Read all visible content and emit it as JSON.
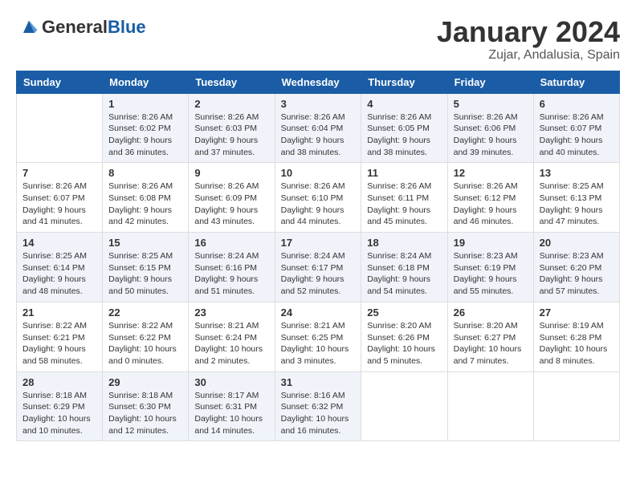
{
  "header": {
    "logo": {
      "general": "General",
      "blue": "Blue"
    },
    "title": "January 2024",
    "subtitle": "Zujar, Andalusia, Spain"
  },
  "weekdays": [
    "Sunday",
    "Monday",
    "Tuesday",
    "Wednesday",
    "Thursday",
    "Friday",
    "Saturday"
  ],
  "weeks": [
    [
      {
        "day": "",
        "sunrise": "",
        "sunset": "",
        "daylight": ""
      },
      {
        "day": "1",
        "sunrise": "Sunrise: 8:26 AM",
        "sunset": "Sunset: 6:02 PM",
        "daylight": "Daylight: 9 hours and 36 minutes."
      },
      {
        "day": "2",
        "sunrise": "Sunrise: 8:26 AM",
        "sunset": "Sunset: 6:03 PM",
        "daylight": "Daylight: 9 hours and 37 minutes."
      },
      {
        "day": "3",
        "sunrise": "Sunrise: 8:26 AM",
        "sunset": "Sunset: 6:04 PM",
        "daylight": "Daylight: 9 hours and 38 minutes."
      },
      {
        "day": "4",
        "sunrise": "Sunrise: 8:26 AM",
        "sunset": "Sunset: 6:05 PM",
        "daylight": "Daylight: 9 hours and 38 minutes."
      },
      {
        "day": "5",
        "sunrise": "Sunrise: 8:26 AM",
        "sunset": "Sunset: 6:06 PM",
        "daylight": "Daylight: 9 hours and 39 minutes."
      },
      {
        "day": "6",
        "sunrise": "Sunrise: 8:26 AM",
        "sunset": "Sunset: 6:07 PM",
        "daylight": "Daylight: 9 hours and 40 minutes."
      }
    ],
    [
      {
        "day": "7",
        "sunrise": "Sunrise: 8:26 AM",
        "sunset": "Sunset: 6:07 PM",
        "daylight": "Daylight: 9 hours and 41 minutes."
      },
      {
        "day": "8",
        "sunrise": "Sunrise: 8:26 AM",
        "sunset": "Sunset: 6:08 PM",
        "daylight": "Daylight: 9 hours and 42 minutes."
      },
      {
        "day": "9",
        "sunrise": "Sunrise: 8:26 AM",
        "sunset": "Sunset: 6:09 PM",
        "daylight": "Daylight: 9 hours and 43 minutes."
      },
      {
        "day": "10",
        "sunrise": "Sunrise: 8:26 AM",
        "sunset": "Sunset: 6:10 PM",
        "daylight": "Daylight: 9 hours and 44 minutes."
      },
      {
        "day": "11",
        "sunrise": "Sunrise: 8:26 AM",
        "sunset": "Sunset: 6:11 PM",
        "daylight": "Daylight: 9 hours and 45 minutes."
      },
      {
        "day": "12",
        "sunrise": "Sunrise: 8:26 AM",
        "sunset": "Sunset: 6:12 PM",
        "daylight": "Daylight: 9 hours and 46 minutes."
      },
      {
        "day": "13",
        "sunrise": "Sunrise: 8:25 AM",
        "sunset": "Sunset: 6:13 PM",
        "daylight": "Daylight: 9 hours and 47 minutes."
      }
    ],
    [
      {
        "day": "14",
        "sunrise": "Sunrise: 8:25 AM",
        "sunset": "Sunset: 6:14 PM",
        "daylight": "Daylight: 9 hours and 48 minutes."
      },
      {
        "day": "15",
        "sunrise": "Sunrise: 8:25 AM",
        "sunset": "Sunset: 6:15 PM",
        "daylight": "Daylight: 9 hours and 50 minutes."
      },
      {
        "day": "16",
        "sunrise": "Sunrise: 8:24 AM",
        "sunset": "Sunset: 6:16 PM",
        "daylight": "Daylight: 9 hours and 51 minutes."
      },
      {
        "day": "17",
        "sunrise": "Sunrise: 8:24 AM",
        "sunset": "Sunset: 6:17 PM",
        "daylight": "Daylight: 9 hours and 52 minutes."
      },
      {
        "day": "18",
        "sunrise": "Sunrise: 8:24 AM",
        "sunset": "Sunset: 6:18 PM",
        "daylight": "Daylight: 9 hours and 54 minutes."
      },
      {
        "day": "19",
        "sunrise": "Sunrise: 8:23 AM",
        "sunset": "Sunset: 6:19 PM",
        "daylight": "Daylight: 9 hours and 55 minutes."
      },
      {
        "day": "20",
        "sunrise": "Sunrise: 8:23 AM",
        "sunset": "Sunset: 6:20 PM",
        "daylight": "Daylight: 9 hours and 57 minutes."
      }
    ],
    [
      {
        "day": "21",
        "sunrise": "Sunrise: 8:22 AM",
        "sunset": "Sunset: 6:21 PM",
        "daylight": "Daylight: 9 hours and 58 minutes."
      },
      {
        "day": "22",
        "sunrise": "Sunrise: 8:22 AM",
        "sunset": "Sunset: 6:22 PM",
        "daylight": "Daylight: 10 hours and 0 minutes."
      },
      {
        "day": "23",
        "sunrise": "Sunrise: 8:21 AM",
        "sunset": "Sunset: 6:24 PM",
        "daylight": "Daylight: 10 hours and 2 minutes."
      },
      {
        "day": "24",
        "sunrise": "Sunrise: 8:21 AM",
        "sunset": "Sunset: 6:25 PM",
        "daylight": "Daylight: 10 hours and 3 minutes."
      },
      {
        "day": "25",
        "sunrise": "Sunrise: 8:20 AM",
        "sunset": "Sunset: 6:26 PM",
        "daylight": "Daylight: 10 hours and 5 minutes."
      },
      {
        "day": "26",
        "sunrise": "Sunrise: 8:20 AM",
        "sunset": "Sunset: 6:27 PM",
        "daylight": "Daylight: 10 hours and 7 minutes."
      },
      {
        "day": "27",
        "sunrise": "Sunrise: 8:19 AM",
        "sunset": "Sunset: 6:28 PM",
        "daylight": "Daylight: 10 hours and 8 minutes."
      }
    ],
    [
      {
        "day": "28",
        "sunrise": "Sunrise: 8:18 AM",
        "sunset": "Sunset: 6:29 PM",
        "daylight": "Daylight: 10 hours and 10 minutes."
      },
      {
        "day": "29",
        "sunrise": "Sunrise: 8:18 AM",
        "sunset": "Sunset: 6:30 PM",
        "daylight": "Daylight: 10 hours and 12 minutes."
      },
      {
        "day": "30",
        "sunrise": "Sunrise: 8:17 AM",
        "sunset": "Sunset: 6:31 PM",
        "daylight": "Daylight: 10 hours and 14 minutes."
      },
      {
        "day": "31",
        "sunrise": "Sunrise: 8:16 AM",
        "sunset": "Sunset: 6:32 PM",
        "daylight": "Daylight: 10 hours and 16 minutes."
      },
      {
        "day": "",
        "sunrise": "",
        "sunset": "",
        "daylight": ""
      },
      {
        "day": "",
        "sunrise": "",
        "sunset": "",
        "daylight": ""
      },
      {
        "day": "",
        "sunrise": "",
        "sunset": "",
        "daylight": ""
      }
    ]
  ]
}
